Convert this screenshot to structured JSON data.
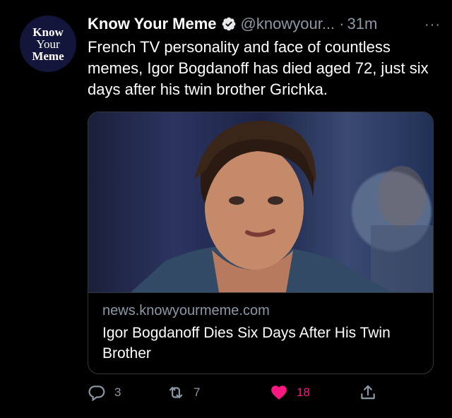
{
  "account": {
    "avatar_lines": [
      "Know",
      "Your",
      "Meme"
    ],
    "display_name": "Know Your Meme",
    "handle": "@knowyour...",
    "separator": "·",
    "time": "31m",
    "more": "···"
  },
  "tweet": {
    "text": "French TV personality and face of countless memes, Igor Bogdanoff has died aged 72, just six days after his twin brother Grichka."
  },
  "card": {
    "domain": "news.knowyourmeme.com",
    "title": "Igor Bogdanoff Dies Six Days After His Twin Brother"
  },
  "actions": {
    "reply_count": "3",
    "retweet_count": "7",
    "like_count": "18"
  },
  "colors": {
    "background": "#000000",
    "text": "#ffffff",
    "muted": "#8b98a5",
    "verified": "#e7e9ea",
    "like": "#f91880",
    "avatar_bg": "#13163a"
  },
  "icons": [
    "verified-badge-icon",
    "more-icon",
    "reply-icon",
    "retweet-icon",
    "like-icon",
    "share-icon"
  ]
}
